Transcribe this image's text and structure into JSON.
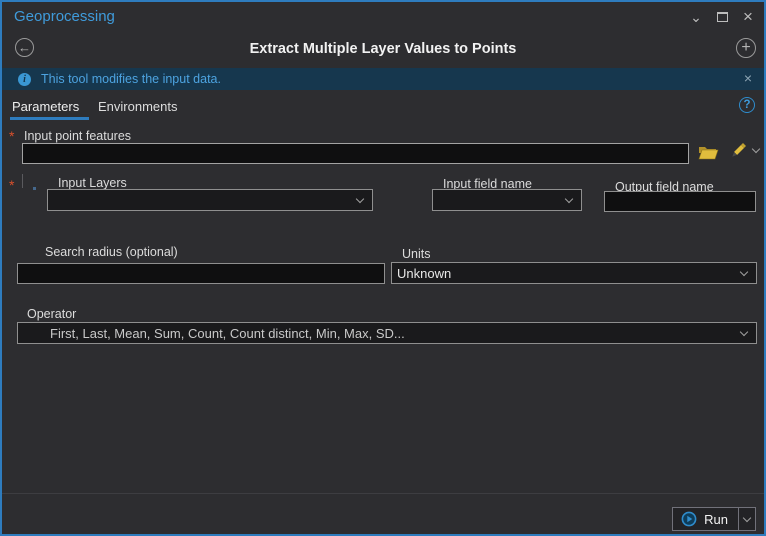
{
  "window": {
    "title": "Geoprocessing",
    "controls": {
      "collapse": "⌄",
      "maximize": "css-box",
      "close": "×"
    }
  },
  "header": {
    "tool_title": "Extract Multiple Layer Values to Points",
    "back_icon": "←",
    "add_icon": "+"
  },
  "message_bar": {
    "text": "This tool modifies the input data.",
    "info_icon": "i",
    "close_icon": "×"
  },
  "tabs": [
    {
      "label": "Parameters",
      "active": true
    },
    {
      "label": "Environments",
      "active": false
    }
  ],
  "help_icon": "?",
  "form": {
    "required_marker": "*",
    "input_point_features": {
      "label": "Input point features",
      "required": true,
      "value": ""
    },
    "input_layers": {
      "label": "Input Layers",
      "required": true,
      "value": ""
    },
    "input_field_name": {
      "label": "Input field name",
      "value": ""
    },
    "output_field_name": {
      "label": "Output field name",
      "value": ""
    },
    "search_radius": {
      "label": "Search radius (optional)",
      "value": ""
    },
    "units": {
      "label": "Units",
      "value": "Unknown"
    },
    "operator": {
      "label": "Operator",
      "value": "First, Last, Mean, Sum, Count, Count distinct, Min, Max, SD..."
    }
  },
  "footer": {
    "run_label": "Run"
  },
  "icons": {
    "browse_folder": "gold-open-folder-svg",
    "edit_pencil": "gold-pencil-svg",
    "run_play": "blue-play-circle-svg",
    "chevron_down": "css-chevron"
  },
  "colors": {
    "accent": "#2e7cbe",
    "pane_title": "#3f9bdb",
    "message_bg": "#16374e",
    "message_text": "#4da3e0",
    "required": "#d9502c",
    "icon_gold": "#ddb93a",
    "background": "#2d2d30",
    "input_bg": "#0f0f10"
  }
}
